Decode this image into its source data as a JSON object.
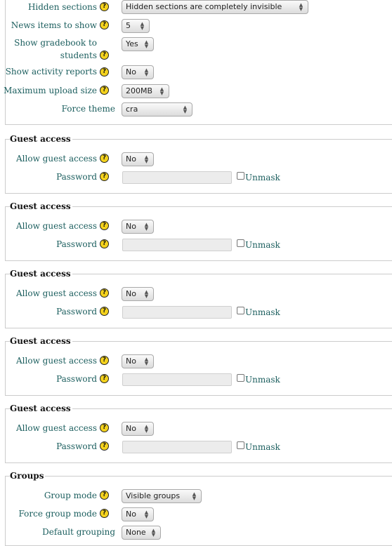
{
  "top": {
    "hidden_sections": {
      "label": "Hidden sections",
      "value": "Hidden sections are completely invisible"
    },
    "news_items": {
      "label": "News items to show",
      "value": "5"
    },
    "show_gradebook": {
      "label_line1": "Show gradebook to",
      "label_line2": "students",
      "value": "Yes"
    },
    "show_activity": {
      "label": "Show activity reports",
      "value": "No"
    },
    "max_upload": {
      "label": "Maximum upload size",
      "value": "200MB"
    },
    "force_theme": {
      "label": "Force theme",
      "value": "cra"
    }
  },
  "guest_sections": [
    {
      "legend": "Guest access",
      "allow_label": "Allow guest access",
      "allow_value": "No",
      "password_label": "Password",
      "unmask_label": "Unmask"
    },
    {
      "legend": "Guest access",
      "allow_label": "Allow guest access",
      "allow_value": "No",
      "password_label": "Password",
      "unmask_label": "Unmask"
    },
    {
      "legend": "Guest access",
      "allow_label": "Allow guest access",
      "allow_value": "No",
      "password_label": "Password",
      "unmask_label": "Unmask"
    },
    {
      "legend": "Guest access",
      "allow_label": "Allow guest access",
      "allow_value": "No",
      "password_label": "Password",
      "unmask_label": "Unmask"
    },
    {
      "legend": "Guest access",
      "allow_label": "Allow guest access",
      "allow_value": "No",
      "password_label": "Password",
      "unmask_label": "Unmask"
    }
  ],
  "groups": {
    "legend": "Groups",
    "group_mode": {
      "label": "Group mode",
      "value": "Visible groups"
    },
    "force_group_mode": {
      "label": "Force group mode",
      "value": "No"
    },
    "default_grouping": {
      "label": "Default grouping",
      "value": "None"
    }
  },
  "help_glyph": "?",
  "arrow_up": "▲",
  "arrow_down": "▼",
  "colors": {
    "label": "#1b5e5e",
    "help": "#f4d21d",
    "border": "#cccccc"
  }
}
